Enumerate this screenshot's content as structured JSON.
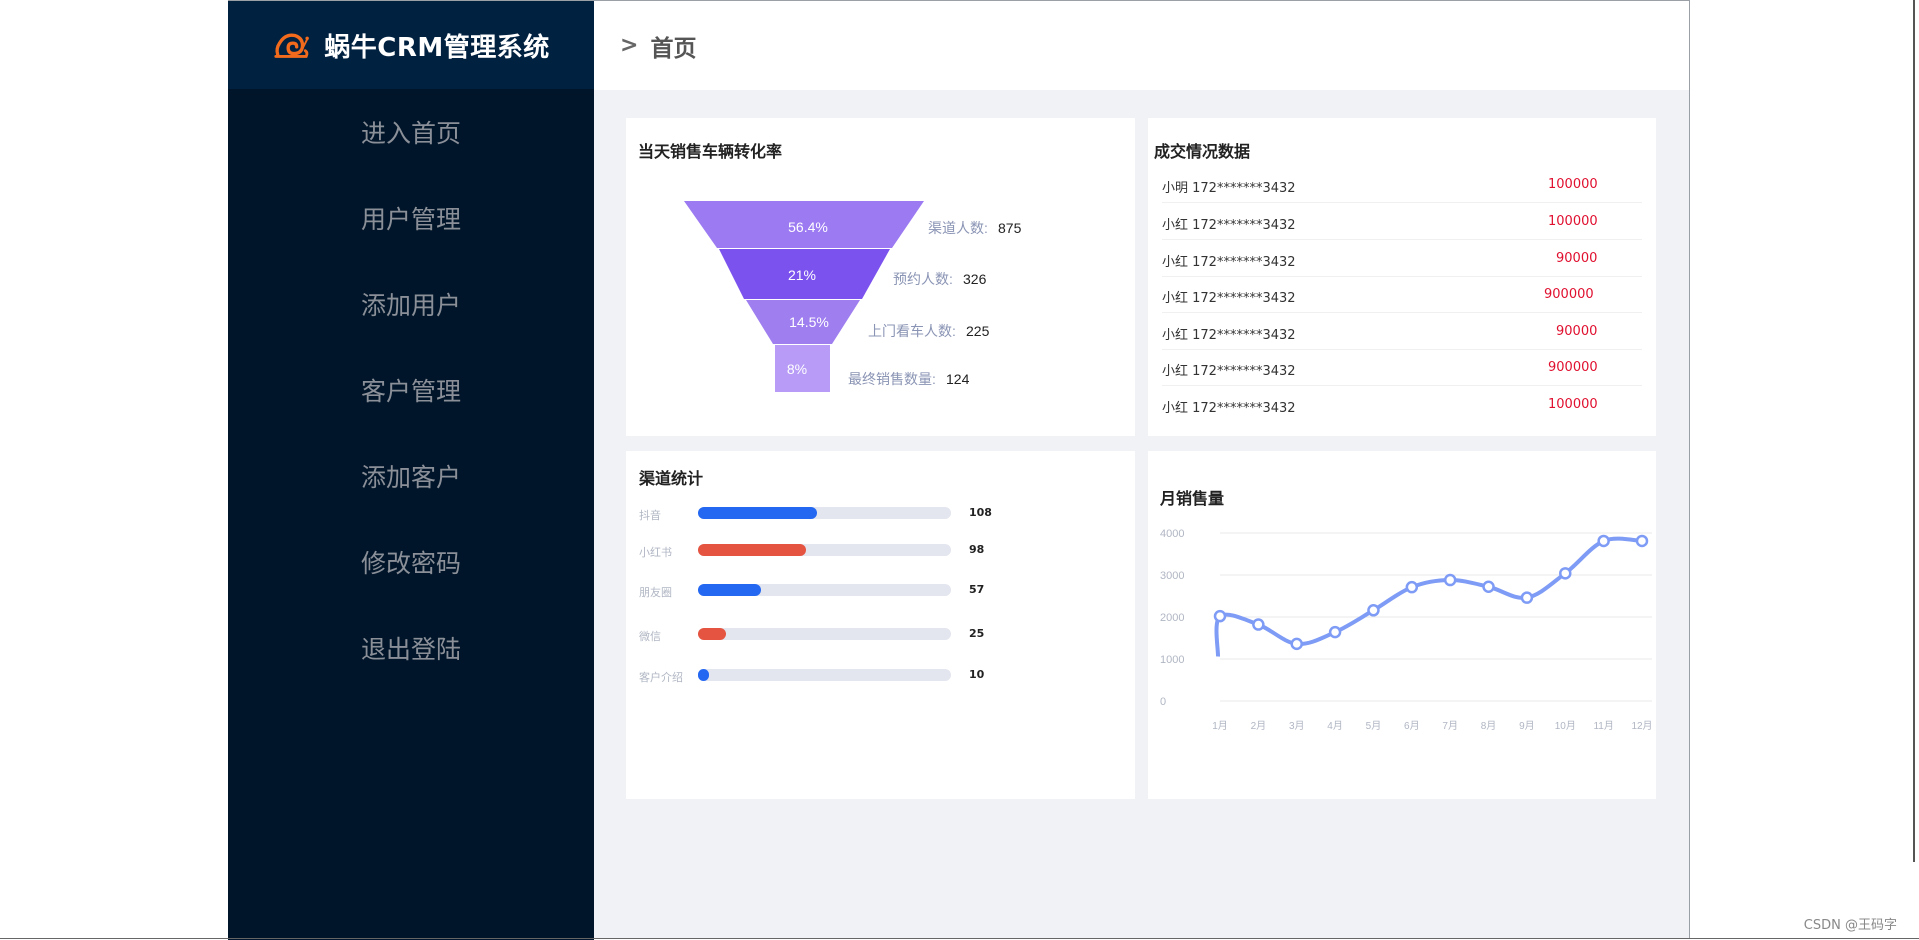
{
  "brand": {
    "title": "蜗牛CRM管理系统",
    "logo_icon": "snail-icon"
  },
  "menu": [
    {
      "label": "进入首页"
    },
    {
      "label": "用户管理"
    },
    {
      "label": "添加用户"
    },
    {
      "label": "客户管理"
    },
    {
      "label": "添加客户"
    },
    {
      "label": "修改密码"
    },
    {
      "label": "退出登陆"
    }
  ],
  "header": {
    "arrow": ">",
    "crumb": "首页"
  },
  "funnel": {
    "title": "当天销售车辆转化率",
    "stages": [
      {
        "percent": "56.4%",
        "label": "渠道人数:",
        "value": "875"
      },
      {
        "percent": "21%",
        "label": "预约人数:",
        "value": "326"
      },
      {
        "percent": "14.5%",
        "label": "上门看车人数:",
        "value": "225"
      },
      {
        "percent": "8%",
        "label": "最终销售数量:",
        "value": "124"
      }
    ]
  },
  "deals": {
    "title": "成交情况数据",
    "rows": [
      {
        "name": "小明 172*******3432",
        "amount": "100000"
      },
      {
        "name": "小红 172*******3432",
        "amount": "100000"
      },
      {
        "name": "小红 172*******3432",
        "amount": "90000"
      },
      {
        "name": "小红 172*******3432",
        "amount": "900000"
      },
      {
        "name": "小红 172*******3432",
        "amount": "90000"
      },
      {
        "name": "小红 172*******3432",
        "amount": "900000"
      },
      {
        "name": "小红 172*******3432",
        "amount": "100000"
      }
    ]
  },
  "channels": {
    "title": "渠道统计",
    "max": 230,
    "colors": {
      "blue": "#2468f2",
      "red": "#e55440",
      "track": "#e3e5ef"
    },
    "items": [
      {
        "label": "抖音",
        "value": 108,
        "color": "#2468f2"
      },
      {
        "label": "小红书",
        "value": 98,
        "color": "#e55440"
      },
      {
        "label": "朋友圈",
        "value": 57,
        "color": "#2468f2"
      },
      {
        "label": "微信",
        "value": 25,
        "color": "#e55440"
      },
      {
        "label": "客户介绍",
        "value": 10,
        "color": "#2468f2"
      }
    ]
  },
  "chart_data": {
    "type": "line",
    "title": "月销售量",
    "categories": [
      "1月",
      "2月",
      "3月",
      "4月",
      "5月",
      "6月",
      "7月",
      "8月",
      "9月",
      "10月",
      "11月",
      "12月"
    ],
    "series": [
      {
        "values": [
          2020,
          1820,
          1360,
          1640,
          2160,
          2710,
          2880,
          2720,
          2460,
          3040,
          3810,
          3810
        ]
      }
    ],
    "y_ticks": [
      "0",
      "1000",
      "2000",
      "3000",
      "4000"
    ],
    "ylim": [
      0,
      4000
    ],
    "grid": true,
    "line_color": "#7e9bf5"
  },
  "watermark": "CSDN @王码字"
}
